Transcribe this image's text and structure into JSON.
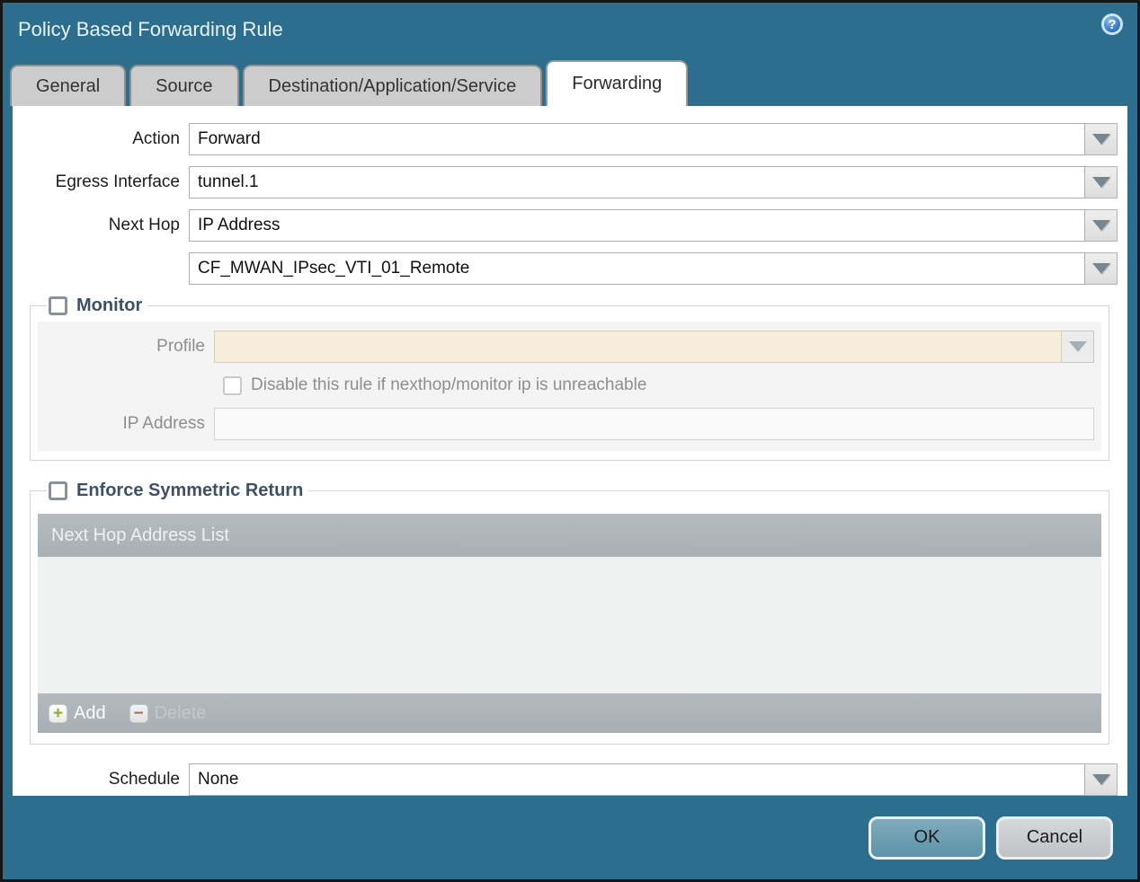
{
  "dialog": {
    "title": "Policy Based Forwarding Rule"
  },
  "tabs": [
    {
      "label": "General",
      "active": false
    },
    {
      "label": "Source",
      "active": false
    },
    {
      "label": "Destination/Application/Service",
      "active": false
    },
    {
      "label": "Forwarding",
      "active": true
    }
  ],
  "form": {
    "action": {
      "label": "Action",
      "value": "Forward"
    },
    "egress_interface": {
      "label": "Egress Interface",
      "value": "tunnel.1"
    },
    "next_hop": {
      "label": "Next Hop",
      "value": "IP Address"
    },
    "next_hop_address": {
      "value": "CF_MWAN_IPsec_VTI_01_Remote"
    },
    "schedule": {
      "label": "Schedule",
      "value": "None"
    }
  },
  "monitor": {
    "legend": "Monitor",
    "checked": false,
    "profile": {
      "label": "Profile",
      "value": ""
    },
    "disable_rule_label": "Disable this rule if nexthop/monitor ip is unreachable",
    "disable_rule_checked": false,
    "ip_address": {
      "label": "IP Address",
      "value": ""
    }
  },
  "symmetric_return": {
    "legend": "Enforce Symmetric Return",
    "checked": false,
    "table_header": "Next Hop Address List",
    "rows": [],
    "add_label": "Add",
    "delete_label": "Delete",
    "delete_enabled": false
  },
  "footer": {
    "ok_label": "OK",
    "cancel_label": "Cancel"
  },
  "icons": {
    "help_glyph": "?",
    "dropdown": "chevron-down-triangle",
    "add_glyph": "+",
    "delete_glyph": "−"
  },
  "colors": {
    "chrome_teal": "#2d6e8e",
    "tab_inactive": "#cccccc",
    "tab_active": "#ffffff",
    "legend_text": "#3e5064",
    "disabled_field_cream": "#f6eeda",
    "table_chrome_gray": "#aeb4b9",
    "table_body_gray": "#f0f1f1",
    "ok_button": "#6a9fb3",
    "cancel_button": "#c9cccf",
    "add_plus_green": "#8fae2f",
    "delete_minus_red": "#a8614a"
  }
}
